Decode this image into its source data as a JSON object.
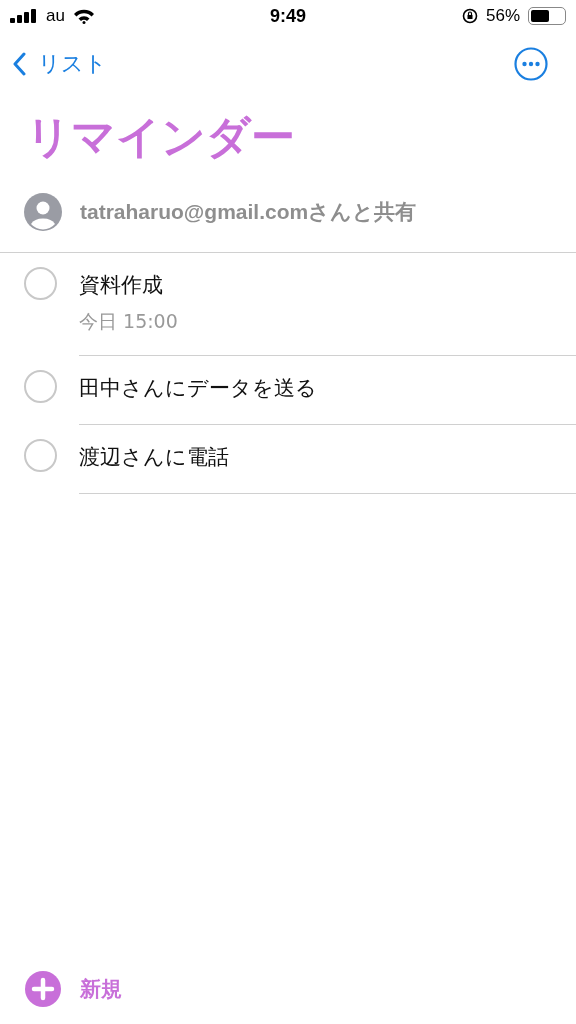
{
  "status_bar": {
    "carrier": "au",
    "time": "9:49",
    "battery": "56%"
  },
  "nav": {
    "back": "リスト"
  },
  "title": "リマインダー",
  "shared": {
    "text": "tatraharuo@gmail.comさんと共有"
  },
  "reminders": [
    {
      "title": "資料作成",
      "due": "今日 15:00",
      "completed": false
    },
    {
      "title": "田中さんにデータを送る",
      "completed": false
    },
    {
      "title": "渡辺さんに電話",
      "completed": false
    }
  ],
  "new_button": "新規"
}
